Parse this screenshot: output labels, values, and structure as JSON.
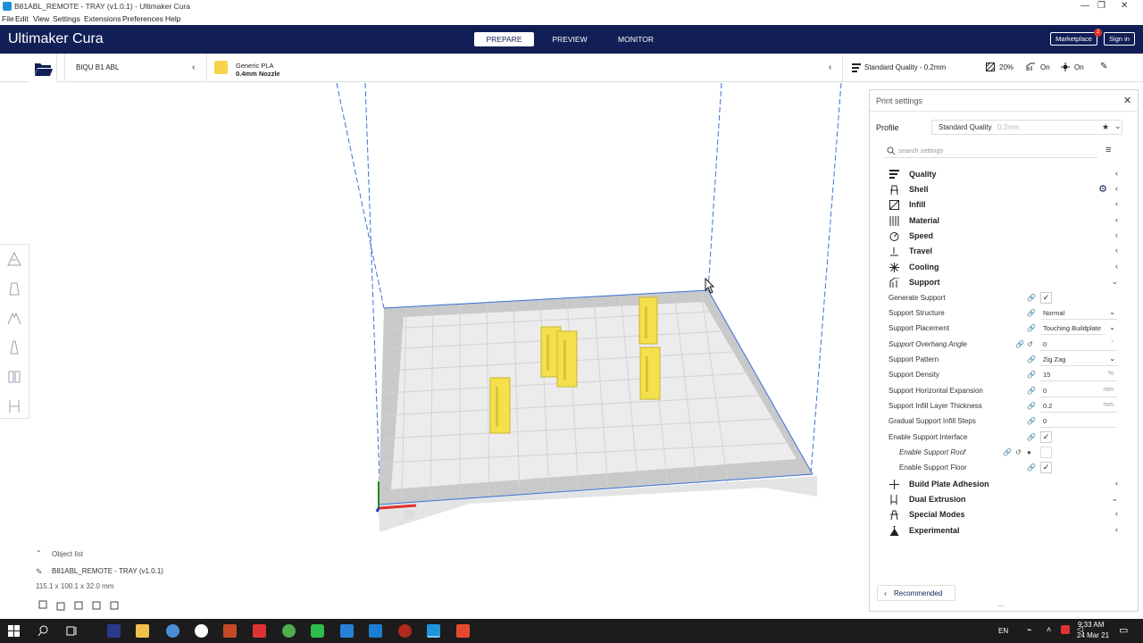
{
  "window": {
    "title": "B81ABL_REMOTE - TRAY (v1.0.1) - Ultimaker Cura"
  },
  "menu": [
    "File",
    "Edit",
    "View",
    "Settings",
    "Extensions",
    "Preferences",
    "Help"
  ],
  "header": {
    "logo": "Ultimaker Cura",
    "tabs": [
      "PREPARE",
      "PREVIEW",
      "MONITOR"
    ],
    "marketplace": "Marketplace",
    "marketplace_badge": "2",
    "signin": "Sign in"
  },
  "toolbar": {
    "printer": "BIQU B1 ABL",
    "material_name": "Generic PLA",
    "nozzle": "0.4mm Nozzle",
    "quality": "Standard Quality - 0.2mm",
    "infill": "20%",
    "support": "On",
    "adhesion": "On"
  },
  "objects": {
    "header": "Object list",
    "name": "B81ABL_REMOTE - TRAY (v1.0.1)",
    "dims": "115.1 x 100.1 x 32.0 mm"
  },
  "panel": {
    "title": "Print settings",
    "profile_label": "Profile",
    "profile_value": "Standard Quality",
    "profile_suffix": "0.2mm",
    "search_placeholder": "search settings",
    "categories_top": [
      "Quality",
      "Shell",
      "Infill",
      "Material",
      "Speed",
      "Travel",
      "Cooling",
      "Support"
    ],
    "support_settings": [
      {
        "label": "Generate Support",
        "type": "check",
        "value": "✓"
      },
      {
        "label": "Support Structure",
        "type": "dropdown",
        "value": "Normal"
      },
      {
        "label": "Support Placement",
        "type": "dropdown",
        "value": "Touching Buildplate"
      },
      {
        "label": "Support Overhang Angle",
        "type": "field",
        "value": "0",
        "unit": "°"
      },
      {
        "label": "Support Pattern",
        "type": "dropdown",
        "value": "Zig Zag"
      },
      {
        "label": "Support Density",
        "type": "field",
        "value": "15",
        "unit": "%"
      },
      {
        "label": "Support Horizontal Expansion",
        "type": "field",
        "value": "0",
        "unit": "mm"
      },
      {
        "label": "Support Infill Layer Thickness",
        "type": "field",
        "value": "0.2",
        "unit": "mm"
      },
      {
        "label": "Gradual Support Infill Steps",
        "type": "field",
        "value": "0",
        "unit": ""
      },
      {
        "label": "Enable Support Interface",
        "type": "check",
        "value": "✓"
      },
      {
        "label": "Enable Support Roof",
        "type": "check",
        "value": ""
      },
      {
        "label": "Enable Support Floor",
        "type": "check",
        "value": "✓"
      }
    ],
    "categories_bottom": [
      "Build Plate Adhesion",
      "Dual Extrusion",
      "Special Modes",
      "Experimental"
    ],
    "recommended": "Recommended"
  },
  "taskbar": {
    "lang": "EN",
    "time": "9:33 AM",
    "date": "24 Mar 21"
  }
}
